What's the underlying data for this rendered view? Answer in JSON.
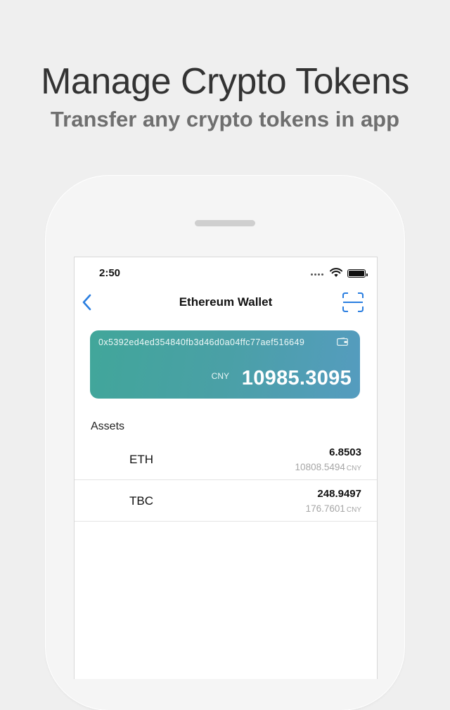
{
  "promo": {
    "headline": "Manage Crypto Tokens",
    "subline": "Transfer any crypto tokens in app"
  },
  "status_bar": {
    "time": "2:50"
  },
  "nav": {
    "title": "Ethereum Wallet",
    "back_icon": "chevron-left-icon",
    "scan_icon": "scan-icon"
  },
  "wallet": {
    "address": "0x5392ed4ed354840fb3d46d0a04ffc77aef516649",
    "currency": "CNY",
    "balance": "10985.3095",
    "gradient_start": "#41a69a",
    "gradient_end": "#559cbf"
  },
  "assets": {
    "title": "Assets",
    "items": [
      {
        "symbol": "ETH",
        "amount": "6.8503",
        "value": "10808.5494",
        "unit": "CNY"
      },
      {
        "symbol": "TBC",
        "amount": "248.9497",
        "value": "176.7601",
        "unit": "CNY"
      }
    ]
  },
  "colors": {
    "accent": "#2a7ee0",
    "background": "#efefef"
  }
}
